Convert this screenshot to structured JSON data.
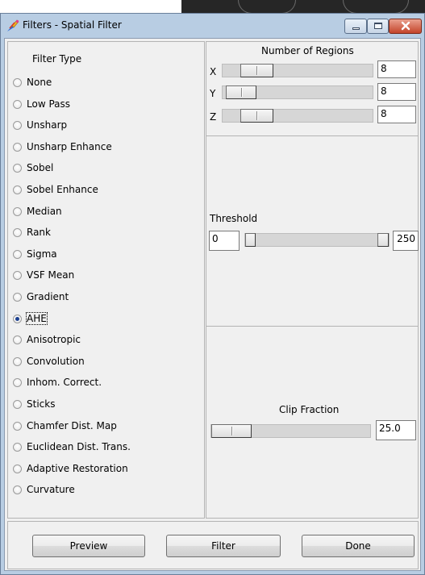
{
  "window": {
    "title": "Filters - Spatial Filter"
  },
  "filter_type": {
    "heading": "Filter Type",
    "selected": "AHE",
    "options": [
      "None",
      "Low Pass",
      "Unsharp",
      "Unsharp Enhance",
      "Sobel",
      "Sobel Enhance",
      "Median",
      "Rank",
      "Sigma",
      "VSF Mean",
      "Gradient",
      "AHE",
      "Anisotropic",
      "Convolution",
      "Inhom. Correct.",
      "Sticks",
      "Chamfer Dist. Map",
      "Euclidean Dist. Trans.",
      "Adaptive Restoration",
      "Curvature"
    ]
  },
  "regions": {
    "heading": "Number of Regions",
    "x": {
      "label": "X",
      "value": "8"
    },
    "y": {
      "label": "Y",
      "value": "8"
    },
    "z": {
      "label": "Z",
      "value": "8"
    }
  },
  "threshold": {
    "heading": "Threshold",
    "min": "0",
    "max": "250"
  },
  "clip": {
    "heading": "Clip Fraction",
    "value": "25.0"
  },
  "buttons": {
    "preview": "Preview",
    "filter": "Filter",
    "done": "Done"
  },
  "colors": {
    "title_bar": "#b8cde3",
    "close_button": "#c4442a",
    "radio_checked": "#1b3f8f"
  }
}
